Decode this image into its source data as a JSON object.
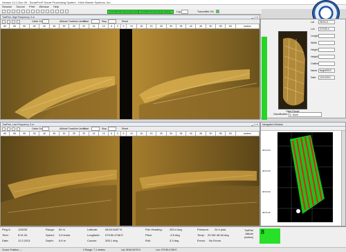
{
  "app": {
    "title": "Version 14.1 Dec 09 - SonarPro® Sonar Processing System - Klein Marine Systems, Inc.",
    "menu": [
      "Session",
      "Source",
      "Print",
      "Window",
      "Help"
    ]
  },
  "toolbar": {
    "status1": "SYSTEM OFF  Recording Inactivity",
    "status2": "SYSTEM ON  Recording Inactivity",
    "log_label": "Log",
    "transmitter": "Transmitter ON"
  },
  "panels": [
    {
      "title": "TowFish, High Frequency, 3 m",
      "controls": {
        "cable_out": "Cable Out",
        "altitude": "Altitude Trackline Limits",
        "start": "Start",
        "stop": "Stop",
        "reset": "Reset"
      },
      "scale": [
        "60",
        "55",
        "50",
        "45",
        "40",
        "35",
        "30",
        "25",
        "20",
        "15",
        "10",
        "5",
        "0",
        "5",
        "10",
        "15",
        "20",
        "25",
        "30",
        "35",
        "40",
        "45",
        "50",
        "55",
        "60"
      ],
      "units": "meters"
    },
    {
      "title": "TowFish, Low Frequency, 3 m",
      "controls": {
        "cable_out": "Cable Out",
        "altitude": "Altitude Trackline Limits",
        "start": "Start",
        "stop": "Stop",
        "reset": "Reset"
      },
      "scale": [
        "60",
        "55",
        "50",
        "45",
        "40",
        "35",
        "30",
        "25",
        "20",
        "15",
        "10",
        "5",
        "0",
        "5",
        "10",
        "15",
        "20",
        "25",
        "30",
        "35",
        "40",
        "45",
        "50",
        "55",
        "60"
      ],
      "units": "meters"
    }
  ],
  "target": {
    "fields": [
      {
        "label": "Lat",
        "value": "08:54.5..."
      },
      {
        "label": "Lon",
        "value": "079:50.4..."
      },
      {
        "label": "Length",
        "value": ""
      },
      {
        "label": "Width",
        "value": ""
      },
      {
        "label": "Height1",
        "value": ""
      },
      {
        "label": "Height2",
        "value": ""
      },
      {
        "label": "Outline",
        "value": ""
      },
      {
        "label": "Name",
        "value": "target0010"
      },
      {
        "label": "Date",
        "value": "12/1/2013"
      }
    ],
    "caption": "Slant Range",
    "classification_label": "Classification",
    "classification_value": "0. None"
  },
  "navigation": {
    "title": "Navigation Window",
    "lat_ticks": [
      "08:54.60",
      "08:54.55",
      "08:54.50",
      "08:54.45"
    ]
  },
  "info": {
    "ping_label": "Ping #:",
    "ping": "128155",
    "time_label": "Time:",
    "time": "8:31:34",
    "date_label": "Date:",
    "date": "12.2.2021",
    "range_label": "Range:",
    "range": "60 m",
    "speed_label": "Speed:",
    "speed": "3.5 knots",
    "depth_label": "Depth:",
    "depth": "6.6 m",
    "lat_label": "Latitude:",
    "lat": "08:54.5487 N",
    "lon_label": "Longitude:",
    "lon": "079:50.4748 E",
    "course_label": "Course:",
    "course": "305.1 deg",
    "heading_label": "Fish Heading:",
    "heading": "283.4 deg",
    "pitch_label": "Pitch:",
    "pitch": "-3.5 deg",
    "roll_label": "Roll:",
    "roll": "3.3 deg",
    "pressure_label": "Pressure:",
    "pressure": "24.4 psia",
    "temp_label": "Temp:",
    "temp": "29.3W 48.3A deg",
    "errors_label": "Errors:",
    "errors": "No Errors",
    "towfish_label": "TowFish",
    "altitude_label": "Altitude",
    "altitude_unit": "(meters)",
    "altitude_value": "8"
  },
  "status": {
    "cursor": "Cursor Position ---",
    "range": "0 Range: 7.1 meters",
    "lat": "Lat: 08:54.5475 N",
    "lon": "Lon: 079:50.4748 E"
  },
  "colors": {
    "sonar_bg": "#4a3a14",
    "sonar_bright": "#d7ad4e",
    "status_green": "#28e028",
    "track_red": "#e01f1f",
    "track_green": "#18c418"
  }
}
